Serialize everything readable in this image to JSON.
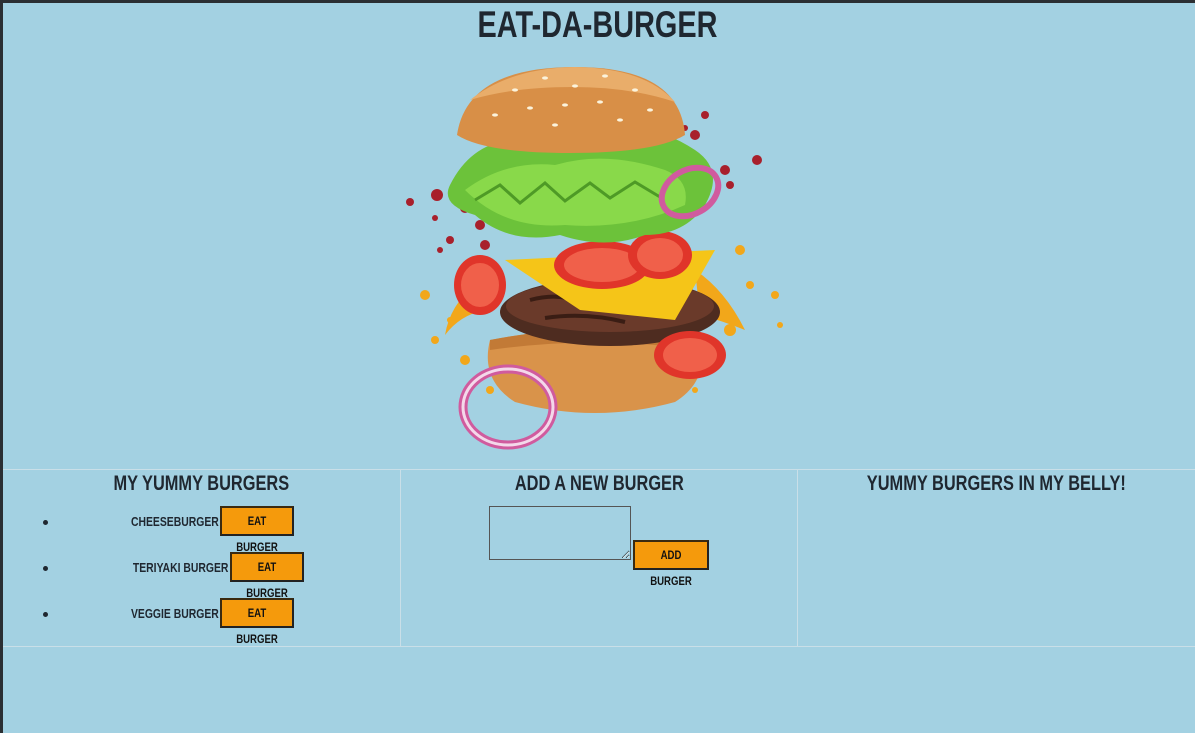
{
  "page": {
    "title": "Eat-Da-Burger"
  },
  "hero": {
    "image": "flying-burger-illustration"
  },
  "columns": {
    "yummy": {
      "heading": "My Yummy Burgers",
      "items": [
        {
          "name": "Cheeseburger",
          "button": "Eat Burger"
        },
        {
          "name": "Teriyaki Burger",
          "button": "Eat Burger"
        },
        {
          "name": "Veggie Burger",
          "button": "Eat Burger"
        }
      ]
    },
    "add": {
      "heading": "Add a New Burger",
      "input_value": "",
      "button": "Add Burger"
    },
    "belly": {
      "heading": "Yummy Burgers in My Belly!",
      "items": []
    }
  },
  "colors": {
    "background": "#a3d1e2",
    "button": "#f59a0c",
    "text": "#1f2730"
  }
}
